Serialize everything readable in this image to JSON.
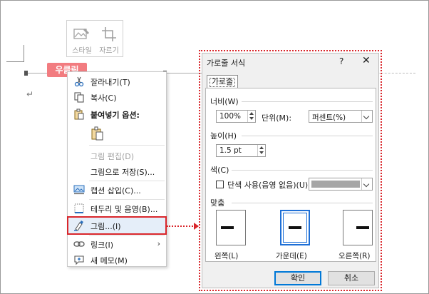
{
  "mini_toolbar": {
    "style_label": "스타일",
    "crop_label": "자르기"
  },
  "badge": {
    "label": "우클릭"
  },
  "context_menu": {
    "cut": "잘라내기(T)",
    "copy": "복사(C)",
    "paste_options": "붙여넣기 옵션:",
    "edit_picture": "그림 편집(D)",
    "save_as_picture": "그림으로 저장(S)...",
    "insert_caption": "캡션 삽입(C)...",
    "borders_shading": "테두리 및 음영(B)...",
    "picture": "그림...(I)",
    "link": "링크(I)",
    "new_comment": "새 메모(M)"
  },
  "dialog": {
    "title": "가로줄 서식",
    "help": "?",
    "close": "✕",
    "tab": "가로줄",
    "width_label": "너비(W)",
    "width_value": "100%",
    "unit_label": "단위(M):",
    "unit_value": "퍼센트(%)",
    "height_label": "높이(H)",
    "height_value": "1.5 pt",
    "color_label": "색(C)",
    "solid_color_label": "단색 사용(음영 없음)(U)",
    "solid_color_checked": false,
    "color_swatch": "#a6a6a6",
    "alignment_label": "맞춤",
    "align_left": "왼쪽(L)",
    "align_center": "가운데(E)",
    "align_right": "오른쪽(R)",
    "selected_alignment": "center",
    "ok_button": "확인",
    "cancel_button": "취소"
  },
  "colors": {
    "highlight_red": "#d9262b",
    "badge_pink": "#f27c80",
    "selected_blue": "#1e6fd6"
  }
}
